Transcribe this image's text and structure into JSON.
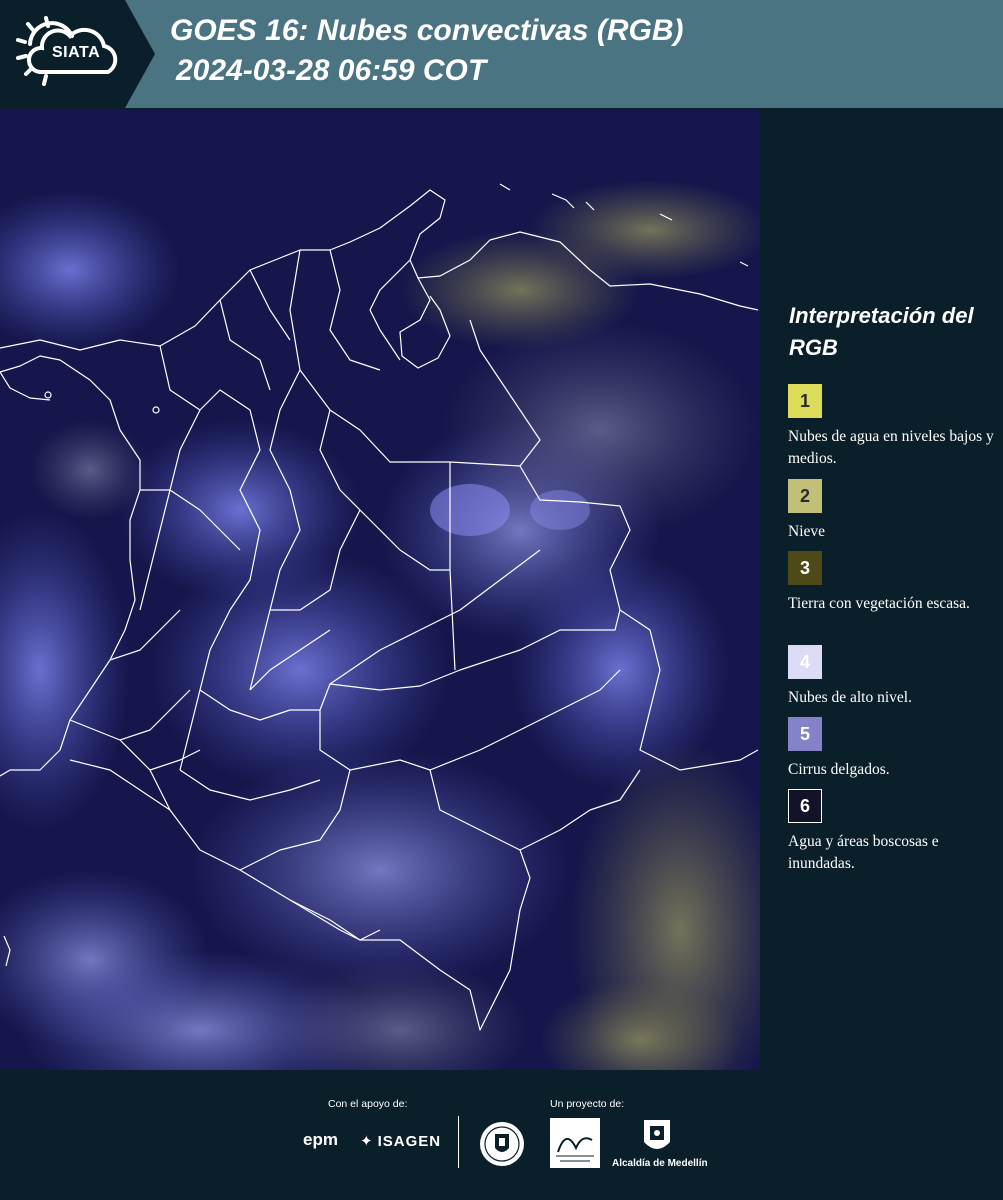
{
  "header": {
    "logo_text": "SIATA",
    "title_line1": "GOES 16: Nubes convectivas (RGB)",
    "title_line2": "2024-03-28 06:59 COT"
  },
  "map": {
    "icon": "satellite-map",
    "colors": {
      "background": "#12144a",
      "clouds": "#6670d8",
      "low_clouds": "#8a8a6a",
      "borders": "#ffffff"
    }
  },
  "legend": {
    "title": "Interpretación del RGB",
    "items": [
      {
        "number": "1",
        "label": "Nubes de agua en niveles bajos y medios.",
        "color": "#dcdc5a"
      },
      {
        "number": "2",
        "label": "Nieve",
        "color": "#c2bf78"
      },
      {
        "number": "3",
        "label": "Tierra con vegetación escasa.",
        "color": "#4e4a18"
      },
      {
        "number": "4",
        "label": "Nubes de alto nivel.",
        "color": "#dcdcf6"
      },
      {
        "number": "5",
        "label": "Cirrus delgados.",
        "color": "#8482c8"
      },
      {
        "number": "6",
        "label": "Agua y áreas boscosas e inundadas.",
        "color": "#121228"
      }
    ]
  },
  "footer": {
    "support_label": "Con el apoyo de:",
    "project_label": "Un proyecto de:",
    "sponsor1": "epm",
    "sponsor2": "ISAGEN",
    "partner3": "Alcaldía de Medellín"
  }
}
